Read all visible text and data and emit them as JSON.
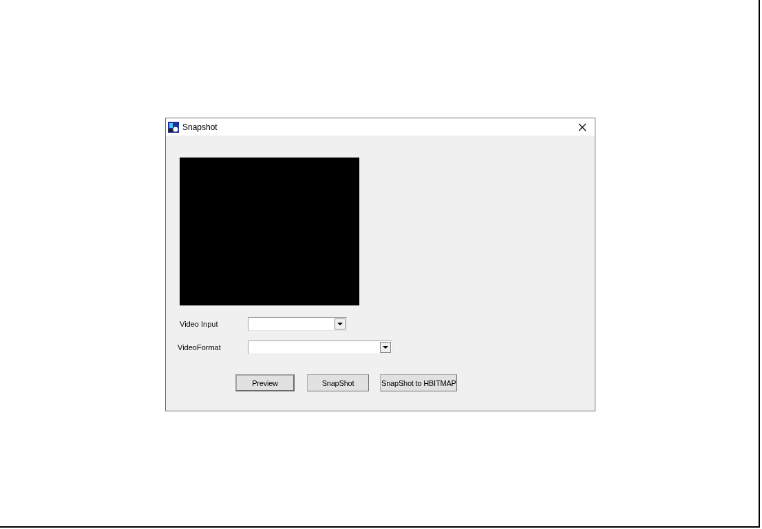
{
  "window": {
    "title": "Snapshot"
  },
  "fields": [
    {
      "label": "Video Input",
      "kind": "short"
    },
    {
      "label": "VideoFormat",
      "kind": "long"
    }
  ],
  "buttons": [
    {
      "label": "Preview",
      "default": true
    },
    {
      "label": "SnapShot",
      "default": false
    },
    {
      "label": "SnapShot to HBITMAP",
      "default": false
    }
  ]
}
